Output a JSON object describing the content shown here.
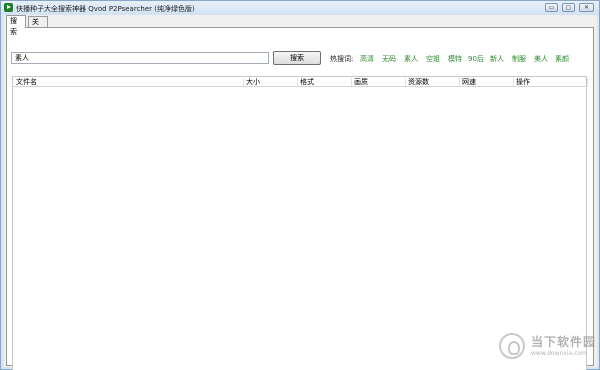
{
  "window": {
    "title": "快播种子大全搜索神器 Qvod P2Psearcher (纯净绿色版)",
    "controls": {
      "minimize": "▭",
      "restore": "▢",
      "close": "✕"
    }
  },
  "tabs": [
    {
      "label": "搜索",
      "active": true
    },
    {
      "label": "关于",
      "active": false
    }
  ],
  "search": {
    "value": "素人",
    "button_label": "搜索"
  },
  "hot": {
    "label": "热搜词:",
    "items": [
      "高清",
      "无码",
      "素人",
      "空姐",
      "模特",
      "90后",
      "新人",
      "制服",
      "美人",
      "素颜"
    ]
  },
  "table": {
    "columns": [
      "文件名",
      "大小",
      "格式",
      "画质",
      "资源数",
      "网速",
      "操作"
    ],
    "rows": []
  },
  "watermark": {
    "name": "当下软件园",
    "url": "www.downxia.com"
  },
  "colors": {
    "hot_link": "#2a8a2a",
    "frame": "#d9e7f5"
  }
}
